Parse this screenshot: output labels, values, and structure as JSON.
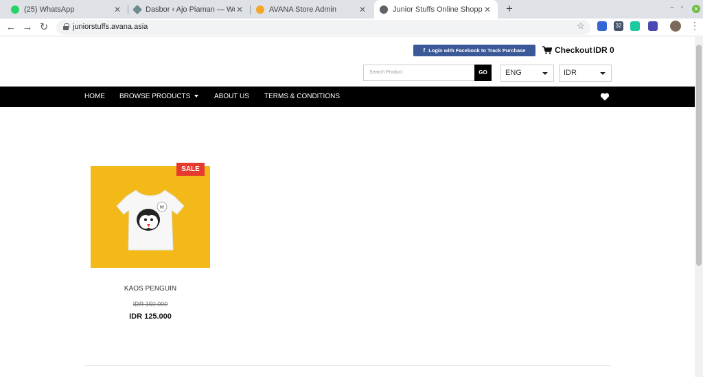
{
  "browser": {
    "tabs": [
      {
        "title": "(25) WhatsApp",
        "favicon_color": "#25d366"
      },
      {
        "title": "Dasbor ‹ Ajo Piaman — WordP",
        "favicon_color": "#6d8b8f"
      },
      {
        "title": "AVANA Store Admin",
        "favicon_color": "#f5a623"
      },
      {
        "title": "Junior Stuffs Online Shopping",
        "favicon_color": "#5f6368"
      }
    ],
    "new_tab": "+",
    "url": "juniorstuffs.avana.asia",
    "ext_badge": "32"
  },
  "header": {
    "fb_login": "Login with Facebook to Track Purchase",
    "checkout": "Checkout",
    "cart_total": "IDR 0",
    "search_placeholder": "Search Product",
    "go": "GO",
    "language": "ENG",
    "currency": "IDR"
  },
  "nav": {
    "home": "HOME",
    "browse": "BROWSE PRODUCTS",
    "about": "ABOUT US",
    "terms": "TERMS & CONDITIONS"
  },
  "product": {
    "badge": "SALE",
    "name": "KAOS PENGUIN",
    "old_price": "IDR 150.000",
    "new_price": "IDR 125.000",
    "bubble_text": "hi!",
    "image_bg": "#f2b919"
  }
}
